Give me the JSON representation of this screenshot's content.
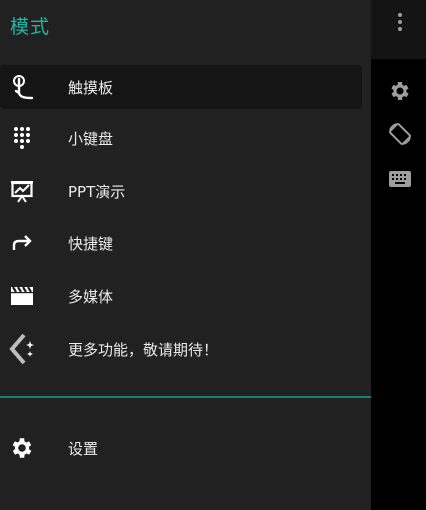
{
  "drawer": {
    "title": "模式",
    "items": [
      {
        "label": "触摸板",
        "icon": "touch-icon",
        "selected": true
      },
      {
        "label": "小键盘",
        "icon": "dialpad-icon"
      },
      {
        "label": "PPT演示",
        "icon": "presentation-icon"
      },
      {
        "label": "快捷键",
        "icon": "forward-arrow-icon"
      },
      {
        "label": "多媒体",
        "icon": "movie-icon"
      },
      {
        "label": "更多功能，敬请期待！",
        "icon": "sparkle-chevron-icon"
      }
    ],
    "settings": {
      "label": "设置",
      "icon": "gear-icon"
    }
  },
  "rightbar": {
    "icons": [
      "more-vert-icon",
      "gear-icon",
      "screen-rotation-icon",
      "keyboard-icon"
    ]
  },
  "colors": {
    "accent": "#1fb5a4",
    "drawer_bg": "#212121",
    "selected_bg": "#151515",
    "divider": "#1a7f75"
  }
}
